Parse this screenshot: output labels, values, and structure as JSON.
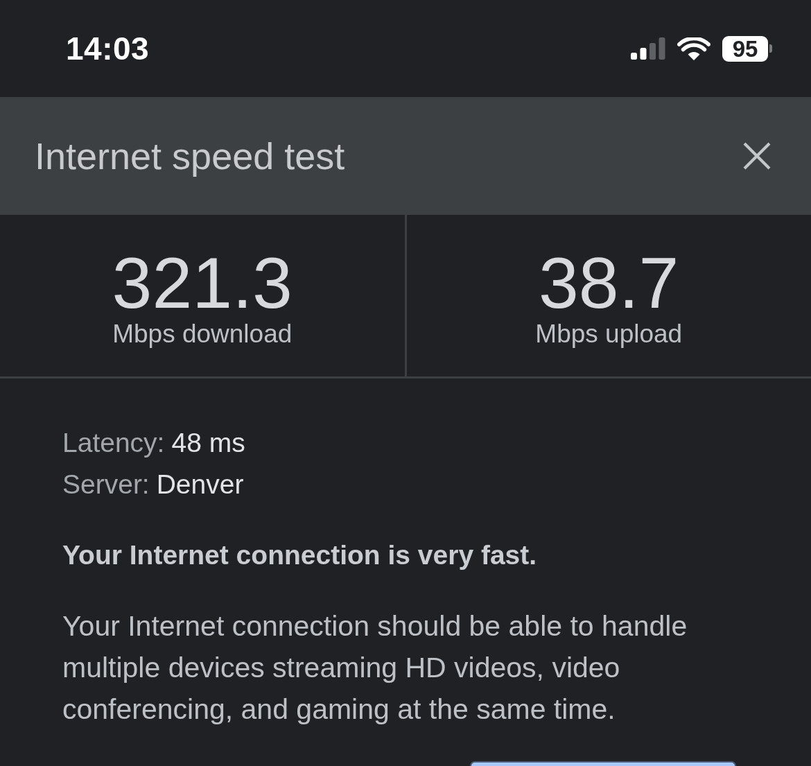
{
  "status_bar": {
    "time": "14:03",
    "battery": "95"
  },
  "header": {
    "title": "Internet speed test"
  },
  "results": [
    {
      "value": "321.3",
      "label": "Mbps download"
    },
    {
      "value": "38.7",
      "label": "Mbps upload"
    }
  ],
  "details": [
    {
      "label": "Latency:",
      "value": "48 ms"
    },
    {
      "label": "Server:",
      "value": "Denver"
    }
  ],
  "summary": "Your Internet connection is very fast.",
  "description": "Your Internet connection should be able to handle multiple devices streaming HD videos, video conferencing, and gaming at the same time."
}
